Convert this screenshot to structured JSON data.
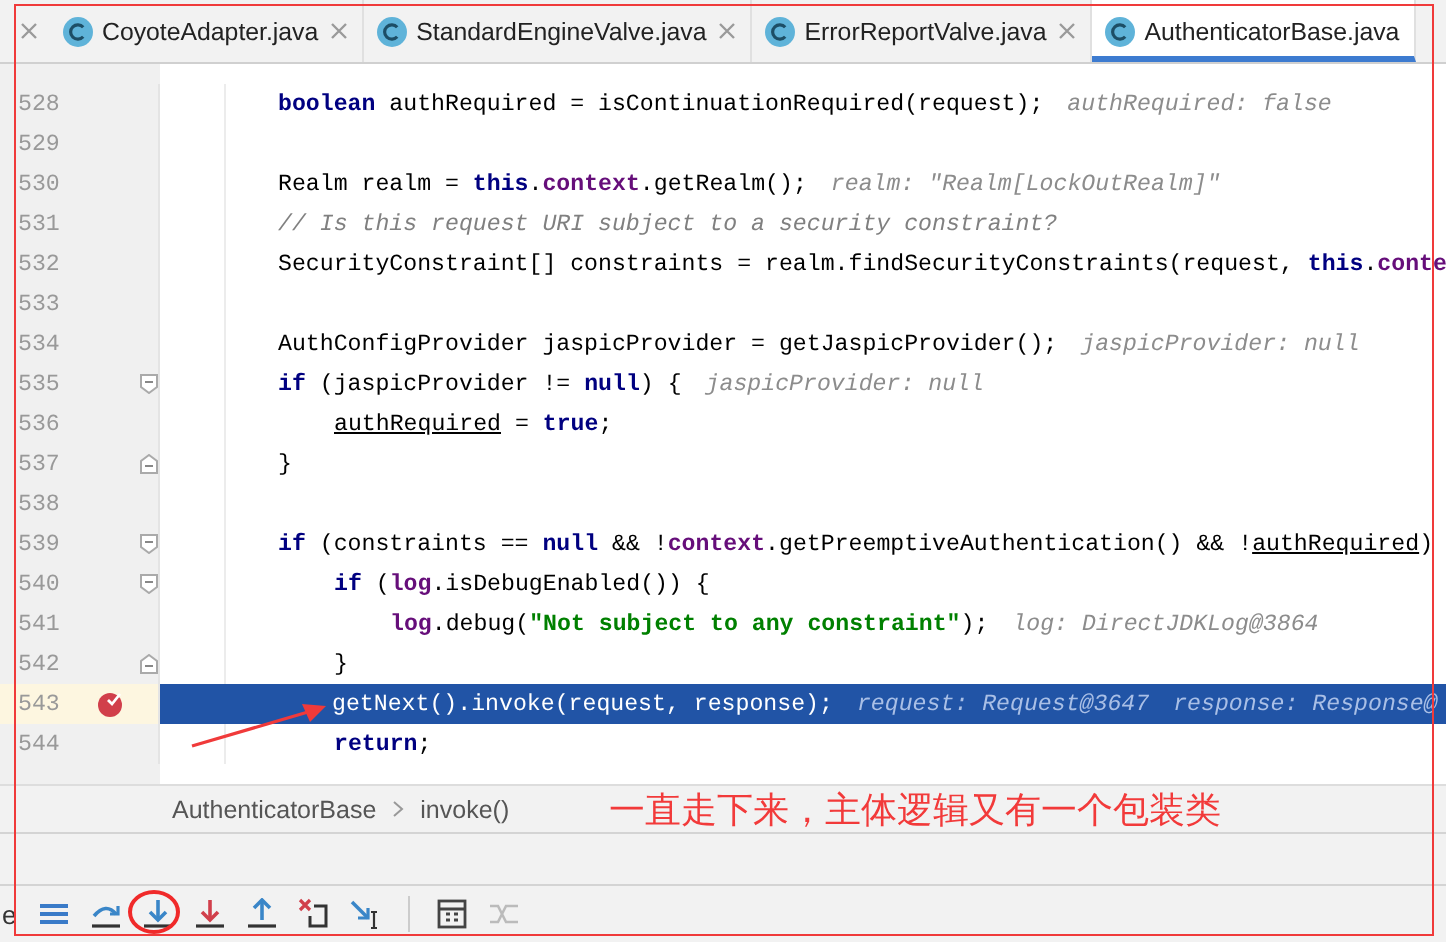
{
  "tabs": [
    {
      "label": "CoyoteAdapter.java",
      "selected": false
    },
    {
      "label": "StandardEngineValve.java",
      "selected": false
    },
    {
      "label": "ErrorReportValve.java",
      "selected": false
    },
    {
      "label": "AuthenticatorBase.java",
      "selected": true
    }
  ],
  "editor": {
    "lines": [
      {
        "number": "528",
        "tokens": [
          {
            "kind": "kw",
            "text": "boolean"
          },
          {
            "kind": "plain",
            "text": " authRequired = isContinuationRequired(request);"
          }
        ],
        "hints": [
          "authRequired: false"
        ],
        "current": false,
        "breakpoint": false
      },
      {
        "number": "529",
        "current": false,
        "breakpoint": false
      },
      {
        "number": "530",
        "tokens": [
          {
            "kind": "plain",
            "text": "Realm realm = "
          },
          {
            "kind": "kw",
            "text": "this"
          },
          {
            "kind": "plain",
            "text": "."
          },
          {
            "kind": "field",
            "text": "context"
          },
          {
            "kind": "plain",
            "text": ".getRealm();"
          }
        ],
        "hints": [
          "realm: \"Realm[LockOutRealm]\""
        ],
        "current": false,
        "breakpoint": false
      },
      {
        "number": "531",
        "tokens": [
          {
            "kind": "comment",
            "text": "// Is this request URI subject to a security constraint?"
          }
        ],
        "current": false,
        "breakpoint": false
      },
      {
        "number": "532",
        "tokens": [
          {
            "kind": "plain",
            "text": "SecurityConstraint[] constraints = realm.findSecurityConstraints(request, "
          },
          {
            "kind": "kw",
            "text": "this"
          },
          {
            "kind": "plain",
            "text": "."
          },
          {
            "kind": "field",
            "text": "conte"
          }
        ],
        "current": false,
        "breakpoint": false
      },
      {
        "number": "533",
        "current": false,
        "breakpoint": false
      },
      {
        "number": "534",
        "tokens": [
          {
            "kind": "plain",
            "text": "AuthConfigProvider jaspicProvider = getJaspicProvider();"
          }
        ],
        "hints": [
          "jaspicProvider: null"
        ],
        "current": false,
        "breakpoint": false
      },
      {
        "number": "535",
        "fold_start": true,
        "tokens": [
          {
            "kind": "kw",
            "text": "if"
          },
          {
            "kind": "plain",
            "text": " (jaspicProvider != "
          },
          {
            "kind": "kw",
            "text": "null"
          },
          {
            "kind": "plain",
            "text": ") {"
          }
        ],
        "hints": [
          "jaspicProvider: null"
        ],
        "current": false,
        "breakpoint": false,
        "children": [
          {
            "number": "536",
            "tokens": [
              {
                "kind": "local",
                "text": "authRequired"
              },
              {
                "kind": "plain",
                "text": " = "
              },
              {
                "kind": "kw",
                "text": "true"
              },
              {
                "kind": "plain",
                "text": ";"
              }
            ],
            "current": false,
            "breakpoint": false
          }
        ]
      },
      {
        "number": "537",
        "fold_end": true,
        "tokens": [
          {
            "kind": "plain",
            "text": "}"
          }
        ],
        "current": false,
        "breakpoint": false
      },
      {
        "number": "538",
        "current": false,
        "breakpoint": false
      },
      {
        "number": "539",
        "fold_start": true,
        "tokens": [
          {
            "kind": "kw",
            "text": "if"
          },
          {
            "kind": "plain",
            "text": " (constraints == "
          },
          {
            "kind": "kw",
            "text": "null"
          },
          {
            "kind": "plain",
            "text": " && !"
          },
          {
            "kind": "field",
            "text": "context"
          },
          {
            "kind": "plain",
            "text": ".getPreemptiveAuthentication() && !"
          },
          {
            "kind": "local",
            "text": "authRequired"
          },
          {
            "kind": "plain",
            "text": ")"
          }
        ],
        "current": false,
        "breakpoint": false,
        "children": [
          {
            "number": "540",
            "fold_start": true,
            "tokens": [
              {
                "kind": "kw",
                "text": "if"
              },
              {
                "kind": "plain",
                "text": " ("
              },
              {
                "kind": "field",
                "text": "log"
              },
              {
                "kind": "plain",
                "text": ".isDebugEnabled()) {"
              }
            ],
            "current": false,
            "breakpoint": false,
            "children": [
              {
                "number": "541",
                "tokens": [
                  {
                    "kind": "field",
                    "text": "log"
                  },
                  {
                    "kind": "plain",
                    "text": ".debug("
                  },
                  {
                    "kind": "str",
                    "text": "\"Not subject to any constraint\""
                  },
                  {
                    "kind": "plain",
                    "text": ");"
                  }
                ],
                "hints": [
                  "log: DirectJDKLog@3864"
                ],
                "current": false,
                "breakpoint": false
              }
            ]
          },
          {
            "number": "542",
            "fold_end": true,
            "tokens": [
              {
                "kind": "plain",
                "text": "}"
              }
            ],
            "current": false,
            "breakpoint": false
          },
          {
            "number": "543",
            "tokens": [
              {
                "kind": "plain",
                "text": "getNext().invoke(request, response);"
              }
            ],
            "hints": [
              "request: Request@3647",
              "response: Response@"
            ],
            "current": true,
            "breakpoint": true
          },
          {
            "number": "544",
            "tokens": [
              {
                "kind": "kw",
                "text": "return"
              },
              {
                "kind": "plain",
                "text": ";"
              }
            ],
            "current": false,
            "breakpoint": false
          }
        ]
      }
    ]
  },
  "breadcrumb": [
    "AuthenticatorBase",
    "invoke()"
  ],
  "annotation": {
    "text": "一直走下来，主体逻辑又有一个包装类"
  },
  "toolbar": {
    "left_text": "e",
    "buttons": [
      {
        "kind": "menu",
        "disabled": false,
        "circled": false
      },
      {
        "kind": "step-over",
        "disabled": false,
        "circled": false
      },
      {
        "kind": "step-into",
        "disabled": false,
        "circled": true
      },
      {
        "kind": "force-step-into",
        "disabled": false,
        "circled": false
      },
      {
        "kind": "step-out",
        "disabled": false,
        "circled": false
      },
      {
        "kind": "drop-frame",
        "disabled": false,
        "circled": false
      },
      {
        "kind": "run-to-cursor",
        "disabled": false,
        "circled": false
      },
      {
        "kind": "separator"
      },
      {
        "kind": "evaluate",
        "disabled": false,
        "circled": false
      },
      {
        "kind": "trace",
        "disabled": true,
        "circled": false
      }
    ]
  }
}
